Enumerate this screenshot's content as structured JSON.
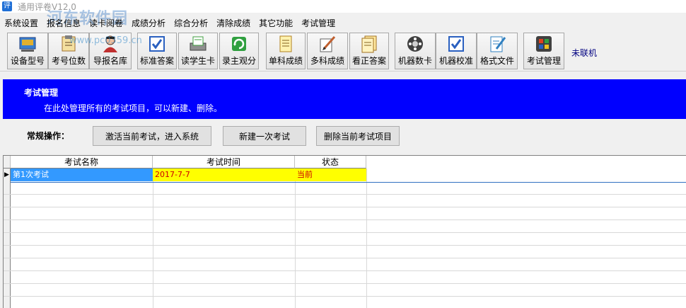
{
  "app": {
    "title": "通用评卷V12.0",
    "watermark": "河东软件园",
    "watermark_url": "www.pc0359.cn"
  },
  "menu": [
    "系统设置",
    "报名信息",
    "读卡阅卷",
    "成绩分析",
    "综合分析",
    "清除成绩",
    "其它功能",
    "考试管理"
  ],
  "toolbar": {
    "buttons": [
      {
        "label": "设备型号",
        "icon": "device-model-icon",
        "color": "#3a7fd0"
      },
      {
        "label": "考号位数",
        "icon": "exam-digits-icon",
        "color": "#c08040"
      },
      {
        "label": "导报名库",
        "icon": "import-registration-icon",
        "color": "#c03030"
      },
      {
        "label": "标准答案",
        "icon": "standard-answer-icon",
        "color": "#2a60c0"
      },
      {
        "label": "读学生卡",
        "icon": "read-student-card-icon",
        "color": "#40a040"
      },
      {
        "label": "录主观分",
        "icon": "subjective-score-icon",
        "color": "#30a040"
      },
      {
        "label": "单科成绩",
        "icon": "single-subject-icon",
        "color": "#d0a030"
      },
      {
        "label": "多科成绩",
        "icon": "multi-subject-icon",
        "color": "#c06030"
      },
      {
        "label": "看正答案",
        "icon": "view-answer-icon",
        "color": "#c09030"
      },
      {
        "label": "机器数卡",
        "icon": "machine-count-icon",
        "color": "#505050"
      },
      {
        "label": "机器校准",
        "icon": "machine-calibrate-icon",
        "color": "#2a60c0"
      },
      {
        "label": "格式文件",
        "icon": "format-file-icon",
        "color": "#3080c0"
      },
      {
        "label": "考试管理",
        "icon": "exam-manage-icon",
        "color": "#e04020"
      }
    ],
    "status": "未联机"
  },
  "banner": {
    "title": "考试管理",
    "description": "在此处管理所有的考试项目，可以新建、删除。",
    "color": "#0000ff"
  },
  "operations": {
    "label": "常规操作：",
    "activate": "激活当前考试，进入系统",
    "new_exam": "新建一次考试",
    "delete_exam": "删除当前考试项目"
  },
  "grid": {
    "columns": [
      "考试名称",
      "考试时间",
      "状态"
    ],
    "rows": [
      {
        "name": "第1次考试",
        "time": "2017-7-7",
        "status": "当前",
        "selected": true
      }
    ],
    "colors": {
      "selection": "#3399ff",
      "highlight": "#ffff00",
      "highlight_text": "#cc0000"
    }
  }
}
